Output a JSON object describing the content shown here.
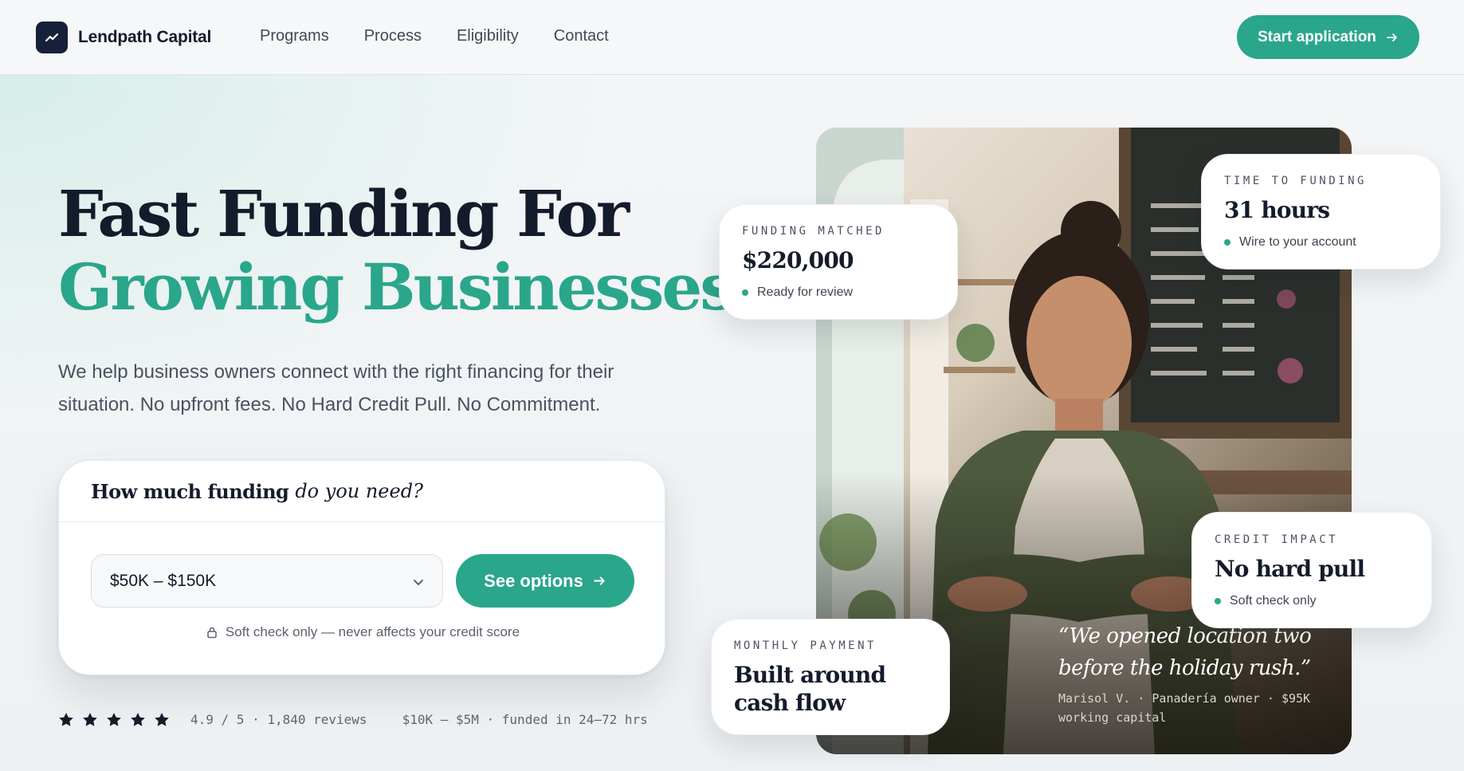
{
  "nav": {
    "brand": "Lendpath Capital",
    "links": [
      "Programs",
      "Process",
      "Eligibility",
      "Contact"
    ],
    "cta": "Start application"
  },
  "hero": {
    "headline_line1": "Fast Funding For",
    "headline_line2": "Growing Businesses",
    "subtext": "We help business owners connect with the right financing for their situation. No upfront fees. No Hard Credit Pull. No Commitment."
  },
  "funding_form": {
    "question_bold": "How much funding",
    "question_italic": "do you need?",
    "selected_amount": "$50K – $150K",
    "button": "See options",
    "note": "Soft check only — never affects your credit score"
  },
  "social_proof": {
    "stars": 5,
    "rating": "4.9 / 5 · 1,840 reviews",
    "funded": "$10K – $5M · funded in 24–72 hrs"
  },
  "stats": {
    "funding": {
      "label": "FUNDING MATCHED",
      "value": "$220,000",
      "sub": "Ready for review"
    },
    "time": {
      "label": "TIME TO FUNDING",
      "value": "31 hours",
      "sub": "Wire to your account"
    },
    "credit": {
      "label": "CREDIT IMPACT",
      "value": "No hard pull",
      "sub": "Soft check only"
    },
    "monthly": {
      "label": "MONTHLY PAYMENT",
      "value": "Built around cash flow"
    }
  },
  "testimonial": {
    "quote": "“We opened location two before the holiday rush.”",
    "attribution": "Marisol V. · Panadería owner · $95K working capital"
  },
  "colors": {
    "accent": "#2aa68b",
    "navy": "#141b2b"
  },
  "icons": {
    "brand": "trend-line-icon",
    "arrow": "arrow-right-icon",
    "chevron": "chevron-down-icon",
    "lock": "lock-icon",
    "star": "star-icon"
  }
}
